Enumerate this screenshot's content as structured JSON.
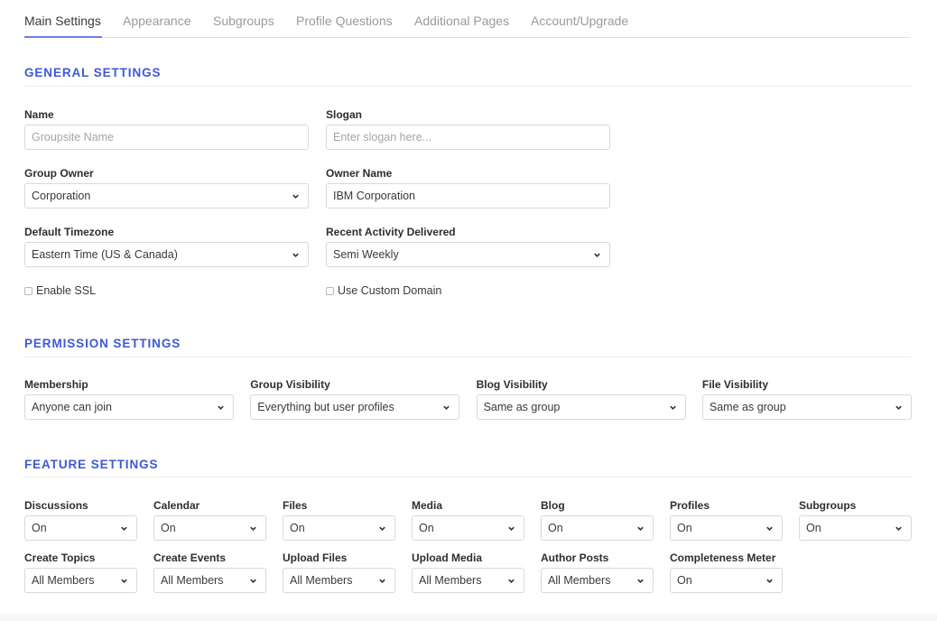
{
  "tabs": [
    {
      "label": "Main Settings",
      "active": true
    },
    {
      "label": "Appearance"
    },
    {
      "label": "Subgroups"
    },
    {
      "label": "Profile Questions"
    },
    {
      "label": "Additional Pages"
    },
    {
      "label": "Account/Upgrade"
    }
  ],
  "colors": {
    "accent": "#3e58d6",
    "tab_underline": "#6b7fe0"
  },
  "general": {
    "title": "GENERAL SETTINGS",
    "name": {
      "label": "Name",
      "value": "",
      "placeholder": "Groupsite Name"
    },
    "slogan": {
      "label": "Slogan",
      "value": "",
      "placeholder": "Enter slogan here..."
    },
    "group_owner": {
      "label": "Group Owner",
      "value": "Corporation"
    },
    "owner_name": {
      "label": "Owner Name",
      "value": "IBM Corporation"
    },
    "timezone": {
      "label": "Default Timezone",
      "value": "Eastern Time (US & Canada)"
    },
    "recent_activity": {
      "label": "Recent Activity Delivered",
      "value": "Semi Weekly"
    },
    "enable_ssl": {
      "label": "Enable SSL",
      "checked": false
    },
    "custom_domain": {
      "label": "Use Custom Domain",
      "checked": false
    }
  },
  "permission": {
    "title": "PERMISSION SETTINGS",
    "fields": [
      {
        "label": "Membership",
        "value": "Anyone can join"
      },
      {
        "label": "Group Visibility",
        "value": "Everything but user profiles"
      },
      {
        "label": "Blog Visibility",
        "value": "Same as group"
      },
      {
        "label": "File Visibility",
        "value": "Same as group"
      }
    ]
  },
  "feature": {
    "title": "FEATURE SETTINGS",
    "row1": [
      {
        "label": "Discussions",
        "value": "On"
      },
      {
        "label": "Calendar",
        "value": "On"
      },
      {
        "label": "Files",
        "value": "On"
      },
      {
        "label": "Media",
        "value": "On"
      },
      {
        "label": "Blog",
        "value": "On"
      },
      {
        "label": "Profiles",
        "value": "On"
      },
      {
        "label": "Subgroups",
        "value": "On"
      }
    ],
    "row2": [
      {
        "label": "Create Topics",
        "value": "All Members"
      },
      {
        "label": "Create Events",
        "value": "All Members"
      },
      {
        "label": "Upload Files",
        "value": "All Members"
      },
      {
        "label": "Upload Media",
        "value": "All Members"
      },
      {
        "label": "Author Posts",
        "value": "All Members"
      },
      {
        "label": "Completeness Meter",
        "value": "On"
      }
    ]
  }
}
